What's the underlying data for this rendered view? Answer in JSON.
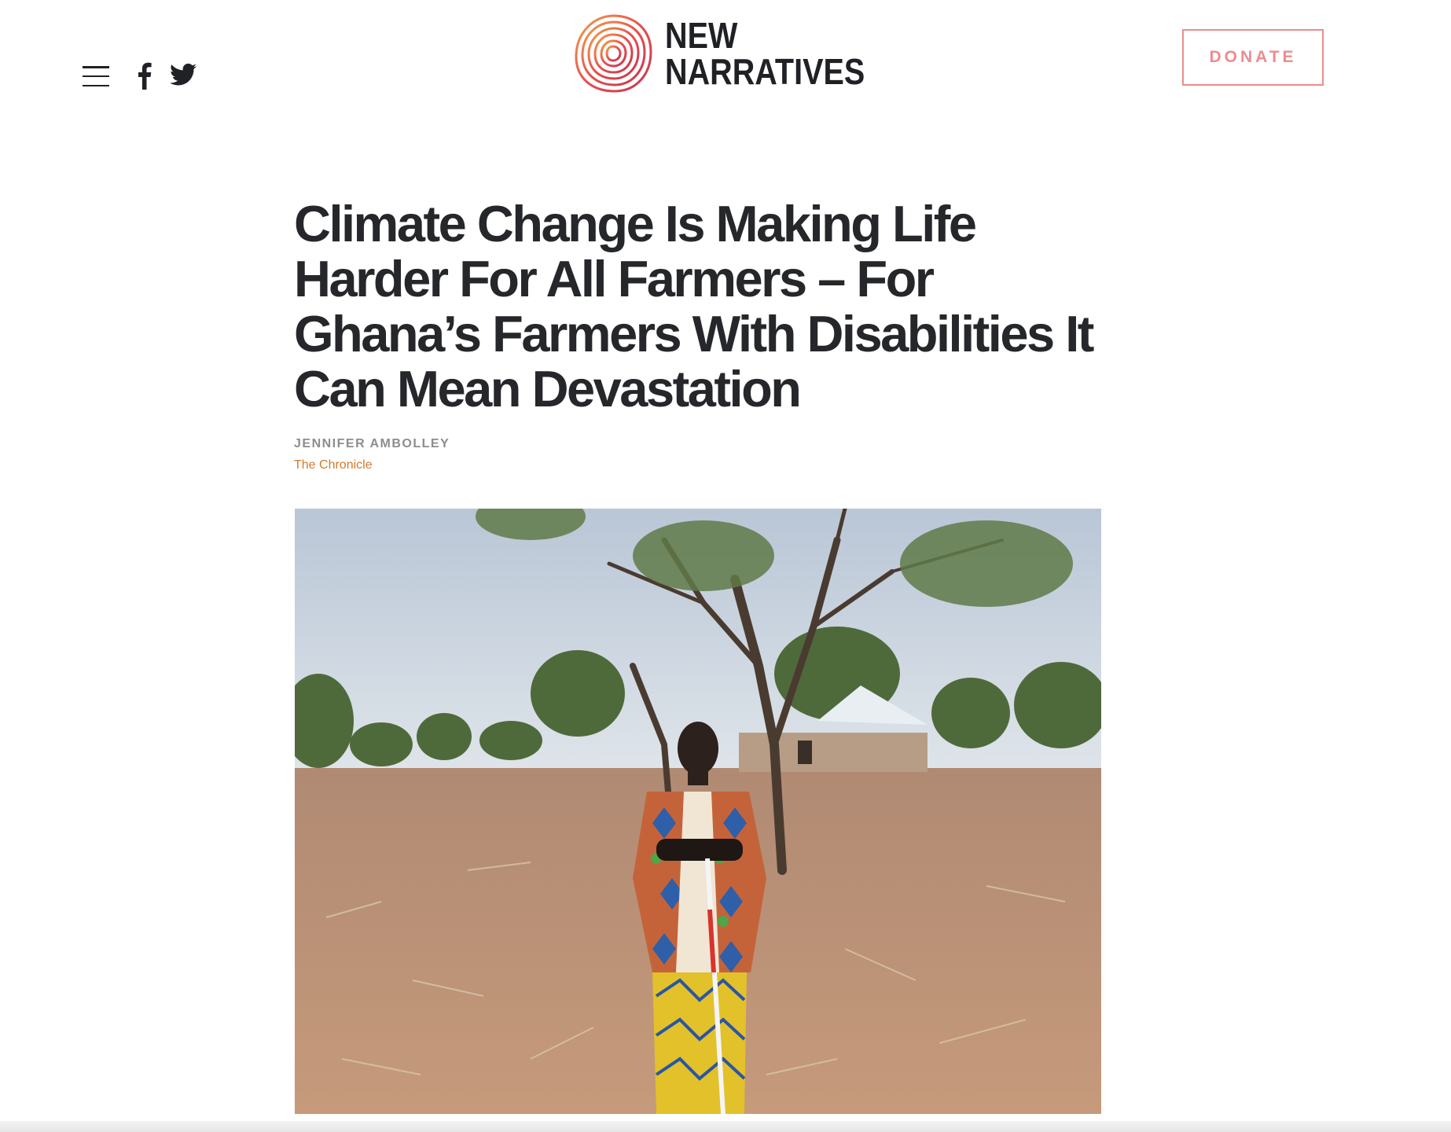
{
  "header": {
    "menu_icon": "hamburger-menu-icon",
    "social": [
      {
        "icon": "facebook-icon"
      },
      {
        "icon": "twitter-icon"
      }
    ],
    "logo": {
      "line1": "NEW",
      "line2": "NARRATIVES",
      "mark_icon": "concentric-rings-logo-icon"
    },
    "donate_label": "DONATE"
  },
  "article": {
    "headline": "Climate Change Is Making Life Harder For All Farmers – For Ghana’s Farmers With Disabilities It Can Mean Devastation",
    "author": "JENNIFER AMBOLLEY",
    "outlet": "The Chronicle"
  },
  "colors": {
    "accent_pink": "#ec8d8d",
    "outlet_orange": "#d57a2a",
    "headline_dark": "#25272b"
  }
}
